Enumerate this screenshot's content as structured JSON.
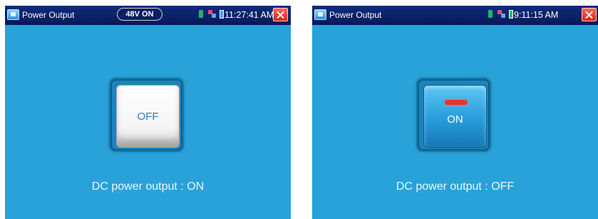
{
  "screens": [
    {
      "app_title": "Power Output",
      "badge": "48V ON",
      "time": "11:27:41 AM",
      "switch_label": "OFF",
      "status_text": "DC power output : ON",
      "icons": [
        "app-icon",
        "sd-card-icon",
        "network-icon",
        "battery-icon",
        "close-icon"
      ]
    },
    {
      "app_title": "Power Output",
      "time": "9:11:15 AM",
      "switch_label": "ON",
      "status_text": "DC power output : OFF",
      "icons": [
        "app-icon",
        "sd-card-icon",
        "network-icon",
        "battery-icon",
        "close-icon"
      ]
    }
  ],
  "colors": {
    "screen_bg": "#29a1d9",
    "topbar_bg": "#0d2c7a",
    "close_red": "#d62316",
    "on_indicator": "#e8322a"
  }
}
